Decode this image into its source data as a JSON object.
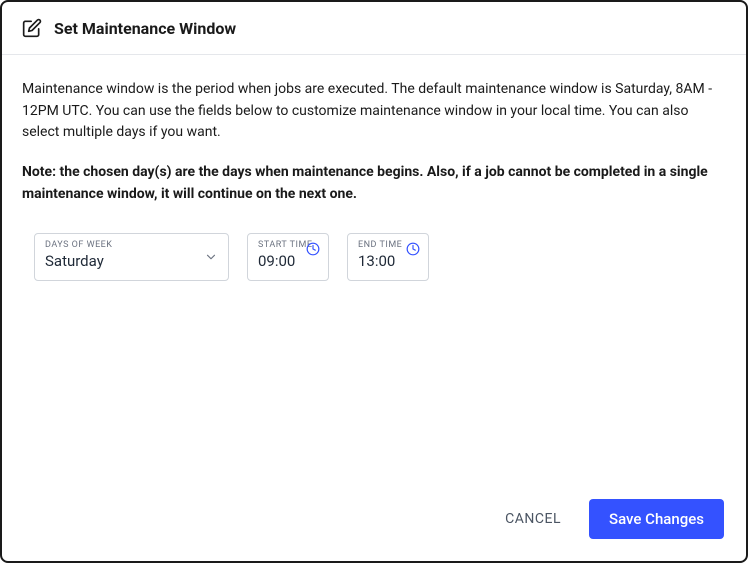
{
  "header": {
    "title": "Set Maintenance Window"
  },
  "body": {
    "description": "Maintenance window is the period when jobs are executed. The default maintenance window is Saturday, 8AM - 12PM UTC. You can use the fields below to customize maintenance window in your local time. You can also select multiple days if you want.",
    "note": "Note: the chosen day(s) are the days when maintenance begins. Also, if a job cannot be completed in a single maintenance window, it will continue on the next one."
  },
  "fields": {
    "days": {
      "label": "DAYS OF WEEK",
      "value": "Saturday"
    },
    "start": {
      "label": "START TIME",
      "value": "09:00"
    },
    "end": {
      "label": "END TIME",
      "value": "13:00"
    }
  },
  "footer": {
    "cancel": "CANCEL",
    "save": "Save Changes"
  }
}
